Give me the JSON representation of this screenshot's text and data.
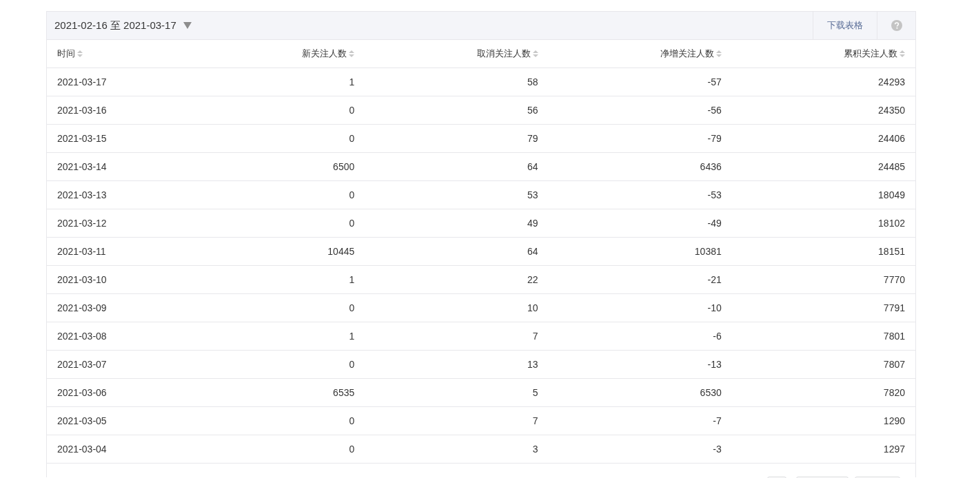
{
  "toolbar": {
    "date_range": "2021-02-16 至 2021-03-17",
    "download_link": "下载表格"
  },
  "table": {
    "columns": [
      "时间",
      "新关注人数",
      "取消关注人数",
      "净增关注人数",
      "累积关注人数"
    ],
    "rows": [
      [
        "2021-03-17",
        "1",
        "58",
        "-57",
        "24293"
      ],
      [
        "2021-03-16",
        "0",
        "56",
        "-56",
        "24350"
      ],
      [
        "2021-03-15",
        "0",
        "79",
        "-79",
        "24406"
      ],
      [
        "2021-03-14",
        "6500",
        "64",
        "6436",
        "24485"
      ],
      [
        "2021-03-13",
        "0",
        "53",
        "-53",
        "18049"
      ],
      [
        "2021-03-12",
        "0",
        "49",
        "-49",
        "18102"
      ],
      [
        "2021-03-11",
        "10445",
        "64",
        "10381",
        "18151"
      ],
      [
        "2021-03-10",
        "1",
        "22",
        "-21",
        "7770"
      ],
      [
        "2021-03-09",
        "0",
        "10",
        "-10",
        "7791"
      ],
      [
        "2021-03-08",
        "1",
        "7",
        "-6",
        "7801"
      ],
      [
        "2021-03-07",
        "0",
        "13",
        "-13",
        "7807"
      ],
      [
        "2021-03-06",
        "6535",
        "5",
        "6530",
        "7820"
      ],
      [
        "2021-03-05",
        "0",
        "7",
        "-7",
        "1290"
      ],
      [
        "2021-03-04",
        "0",
        "3",
        "-3",
        "1297"
      ]
    ]
  }
}
